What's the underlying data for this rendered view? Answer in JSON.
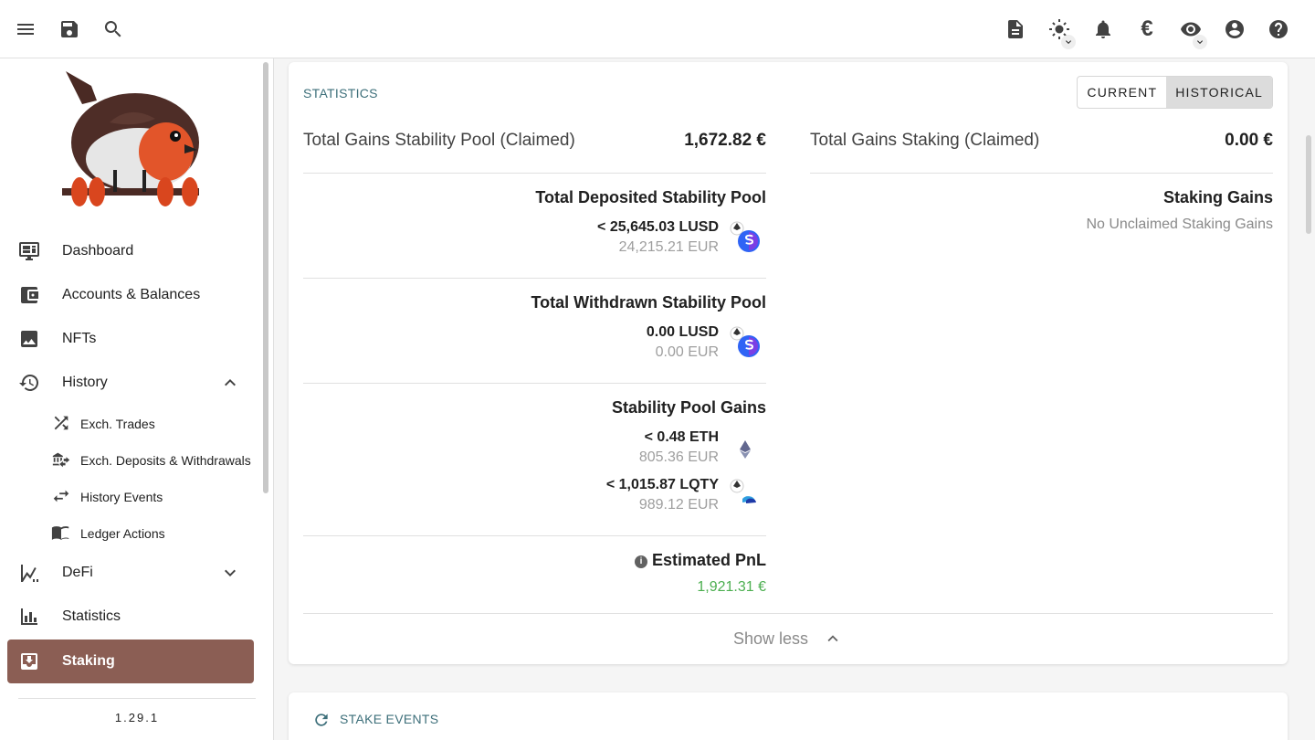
{
  "topbar": {
    "left_icons": [
      "menu-icon",
      "save-icon",
      "search-icon"
    ],
    "right_icons": [
      "notes-icon",
      "theme-icon",
      "notifications-icon",
      "currency-icon",
      "privacy-icon",
      "account-icon",
      "help-icon"
    ],
    "currency_symbol": "€"
  },
  "sidebar": {
    "items": [
      {
        "label": "Dashboard",
        "icon": "monitor-dashboard-icon"
      },
      {
        "label": "Accounts & Balances",
        "icon": "wallet-icon"
      },
      {
        "label": "NFTs",
        "icon": "image-icon"
      },
      {
        "label": "History",
        "icon": "history-icon",
        "expanded": true
      },
      {
        "label": "DeFi",
        "icon": "chart-areaspline-icon",
        "expanded": false
      },
      {
        "label": "Statistics",
        "icon": "bar-chart-icon"
      },
      {
        "label": "Staking",
        "icon": "inbox-arrow-down-icon",
        "active": true
      }
    ],
    "history_sub": [
      {
        "label": "Exch. Trades",
        "icon": "shuffle-icon"
      },
      {
        "label": "Exch. Deposits & Withdrawals",
        "icon": "bank-transfer-icon"
      },
      {
        "label": "History Events",
        "icon": "swap-horizontal-icon"
      },
      {
        "label": "Ledger Actions",
        "icon": "book-open-icon"
      }
    ],
    "version": "1.29.1",
    "active_color": "#8b5e54"
  },
  "statistics": {
    "title": "STATISTICS",
    "toggle": {
      "current": "CURRENT",
      "historical": "HISTORICAL",
      "selected": "HISTORICAL"
    },
    "left": {
      "total_label": "Total Gains Stability Pool (Claimed)",
      "total_value": "1,672.82 €",
      "deposited": {
        "title": "Total Deposited Stability Pool",
        "amount": "< 25,645.03 LUSD",
        "fiat": "24,215.21 EUR"
      },
      "withdrawn": {
        "title": "Total Withdrawn Stability Pool",
        "amount": "0.00 LUSD",
        "fiat": "0.00 EUR"
      },
      "gains": {
        "title": "Stability Pool Gains",
        "eth_amount": "< 0.48 ETH",
        "eth_fiat": "805.36 EUR",
        "lqty_amount": "< 1,015.87 LQTY",
        "lqty_fiat": "989.12 EUR"
      },
      "pnl": {
        "title": "Estimated PnL",
        "value": "1,921.31 €",
        "color": "#4caf50"
      }
    },
    "right": {
      "total_label": "Total Gains Staking (Claimed)",
      "total_value": "0.00 €",
      "staking_gains_title": "Staking Gains",
      "staking_gains_empty": "No Unclaimed Staking Gains"
    },
    "show_less": "Show less"
  },
  "stake_events": {
    "title": "STAKE EVENTS"
  }
}
